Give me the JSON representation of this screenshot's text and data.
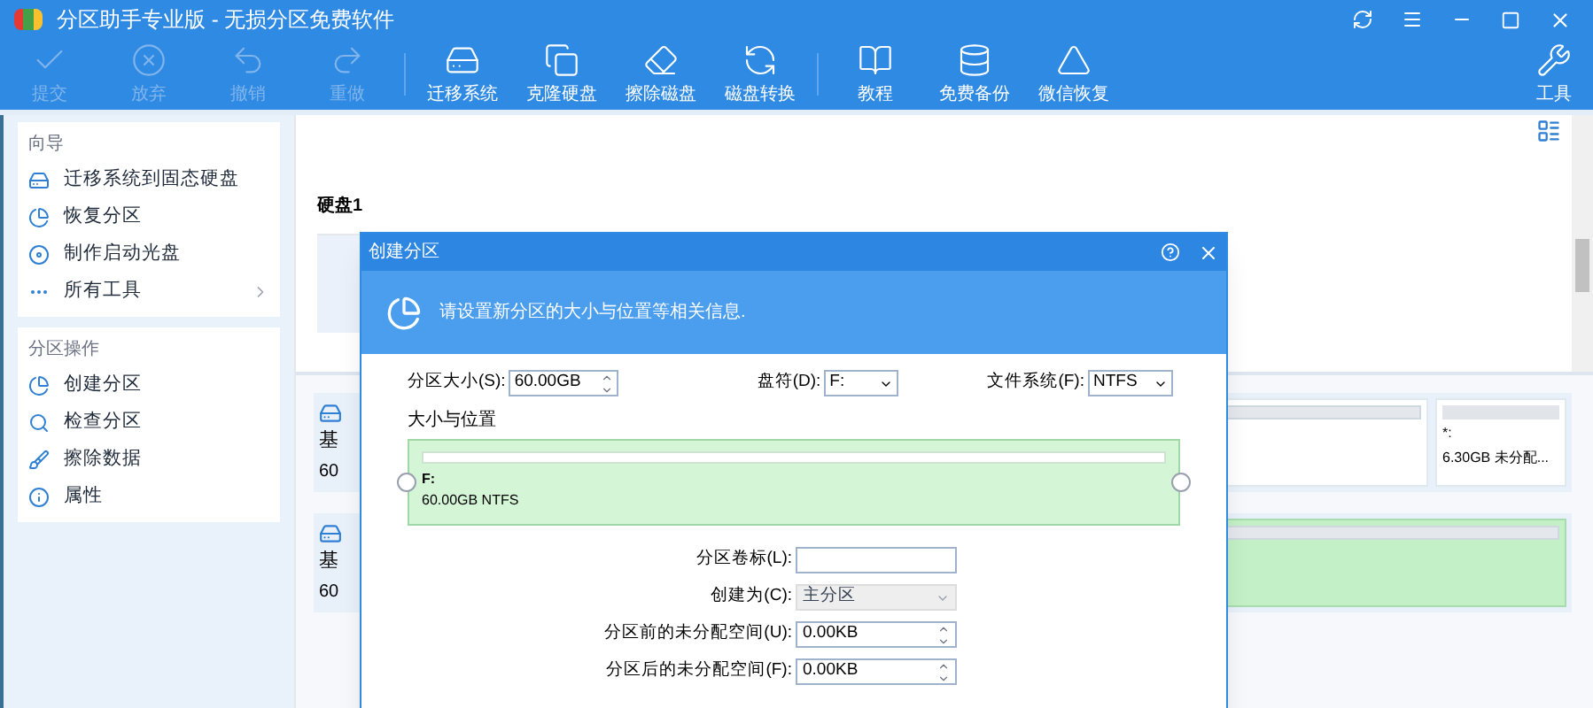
{
  "window": {
    "title": "分区助手专业版 - 无损分区免费软件"
  },
  "toolbar": [
    {
      "label": "提交",
      "kind": "check",
      "disabled": true
    },
    {
      "label": "放弃",
      "kind": "discard",
      "disabled": true
    },
    {
      "label": "撤销",
      "kind": "undo",
      "disabled": true
    },
    {
      "label": "重做",
      "kind": "redo",
      "disabled": true
    },
    {
      "label": "迁移系统",
      "kind": "migrate",
      "disabled": false
    },
    {
      "label": "克隆硬盘",
      "kind": "clone",
      "disabled": false
    },
    {
      "label": "擦除磁盘",
      "kind": "wipe",
      "disabled": false
    },
    {
      "label": "磁盘转换",
      "kind": "convert",
      "disabled": false
    },
    {
      "label": "教程",
      "kind": "book",
      "disabled": false
    },
    {
      "label": "免费备份",
      "kind": "backup",
      "disabled": false
    },
    {
      "label": "微信恢复",
      "kind": "recover",
      "disabled": false
    }
  ],
  "tools_button": {
    "label": "工具"
  },
  "sidebar": [
    {
      "title": "向导",
      "items": [
        {
          "label": "迁移系统到固态硬盘",
          "kind": "drive",
          "submenu": false
        },
        {
          "label": "恢复分区",
          "kind": "pie",
          "submenu": false
        },
        {
          "label": "制作启动光盘",
          "kind": "disc",
          "submenu": false
        },
        {
          "label": "所有工具",
          "kind": "more",
          "submenu": true
        }
      ]
    },
    {
      "title": "分区操作",
      "items": [
        {
          "label": "创建分区",
          "kind": "pie",
          "submenu": false
        },
        {
          "label": "检查分区",
          "kind": "search",
          "submenu": false
        },
        {
          "label": "擦除数据",
          "kind": "wipe",
          "submenu": false
        },
        {
          "label": "属性",
          "kind": "info",
          "submenu": false
        }
      ]
    }
  ],
  "disk_label": "硬盘1",
  "disk_rows": [
    {
      "name": "基",
      "size": "60",
      "partitions": [
        {
          "label": "*:",
          "detail": "6.30GB 未分配..."
        }
      ]
    },
    {
      "name": "基",
      "size": "60",
      "partitions": []
    }
  ],
  "dialog": {
    "title": "创建分区",
    "banner": "请设置新分区的大小与位置等相关信息.",
    "size_label": "分区大小(S):",
    "size_value": "60.00GB",
    "letter_label": "盘符(D):",
    "letter_value": "F:",
    "fs_label": "文件系统(F):",
    "fs_value": "NTFS",
    "section_title": "大小与位置",
    "partition": {
      "name": "F:",
      "detail": "60.00GB NTFS"
    },
    "fields": [
      {
        "label": "分区卷标(L):",
        "kind": "text",
        "disabled": false
      },
      {
        "label": "创建为(C):",
        "kind": "select",
        "value": "主分区",
        "disabled": true
      },
      {
        "label": "分区前的未分配空间(U):",
        "kind": "spin",
        "value": "0.00KB",
        "disabled": false
      },
      {
        "label": "分区后的未分配空间(F):",
        "kind": "spin",
        "value": "0.00KB",
        "disabled": false
      }
    ]
  }
}
